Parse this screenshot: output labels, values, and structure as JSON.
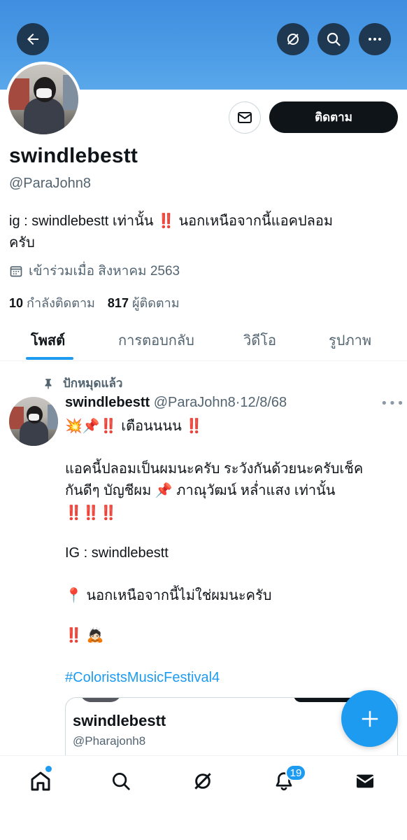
{
  "header": {
    "back_icon": "arrow-left-icon",
    "grok_icon": "grok-icon",
    "search_icon": "search-icon",
    "more_icon": "more-horizontal-icon"
  },
  "profile": {
    "display_name": "swindlebestt",
    "handle": "@ParaJohn8",
    "bio_line1": "ig : swindlebestt เท่านั้น ‼️ นอกเหนือจากนี้แอคปลอม",
    "bio_line2": "ครับ",
    "joined": "เข้าร่วมเมื่อ สิงหาคม 2563",
    "following_count": "10",
    "following_label": "กำลังติดตาม",
    "followers_count": "817",
    "followers_label": "ผู้ติดตาม",
    "follow_button": "ติดตาม"
  },
  "tabs": [
    {
      "label": "โพสต์",
      "active": true
    },
    {
      "label": "การตอบกลับ",
      "active": false
    },
    {
      "label": "วิดีโอ",
      "active": false
    },
    {
      "label": "รูปภาพ",
      "active": false
    }
  ],
  "pinned_post": {
    "pinned_label": "ปักหมุดแล้ว",
    "author_name": "swindlebestt",
    "author_handle": "@ParaJohn8",
    "separator": "·",
    "date": "12/8/68",
    "lines": [
      "💥📌‼️ เตือนนนน ‼️",
      "แอคนี้ปลอมเป็นผมนะครับ  ระวังกันด้วยนะครับเช็ค",
      "กันดีๆ บัญชีผม 📌 ภาณุวัฒน์ หล่ำแสง เท่านั้น",
      "‼️‼️‼️",
      "IG : swindlebestt",
      "📍 นอกเหนือจากนี้ไม่ใช่ผมนะครับ",
      "‼️ 🙇🏻"
    ],
    "hashtag": "#ColoristsMusicFestival4",
    "quoted_card": {
      "name": "swindlebestt",
      "handle": "@Pharajonh8"
    }
  },
  "bottom_nav": {
    "items": [
      "home-icon",
      "search-icon",
      "grok-icon",
      "notifications-icon",
      "messages-icon"
    ],
    "notification_count": "19"
  },
  "colors": {
    "accent": "#1d9bf0",
    "banner": "#4c9ce6",
    "text": "#0f1419",
    "secondary": "#536471"
  }
}
